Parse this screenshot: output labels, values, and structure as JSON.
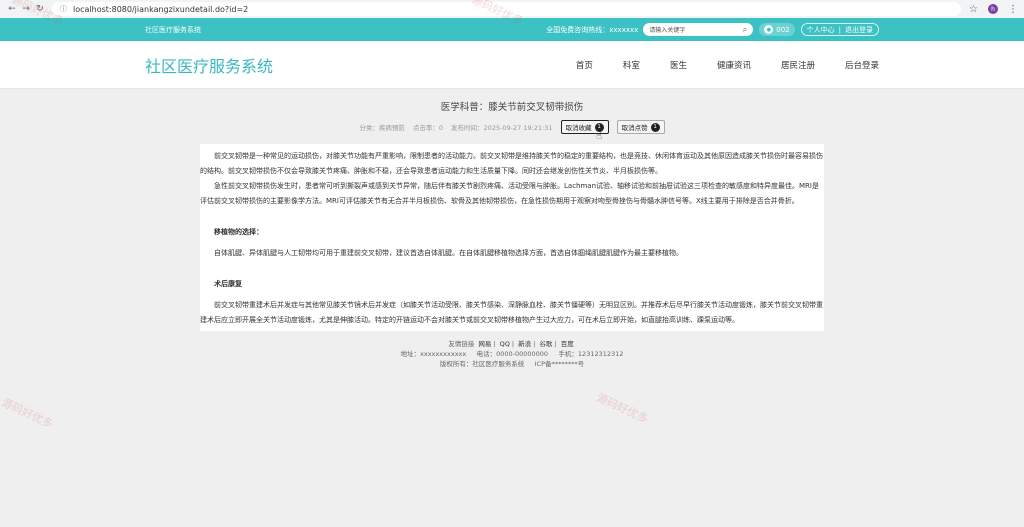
{
  "browser": {
    "url": "localhost:8080/jiankangzixundetail.do?id=2",
    "profile_initial": "h"
  },
  "topbar": {
    "site_name": "社区医疗服务系统",
    "hotline_label": "全国免费咨询热线：",
    "hotline_number": "xxxxxxx",
    "search_placeholder": "请输入关键字",
    "user": "002",
    "user_center": "个人中心",
    "logout": "退出登录"
  },
  "header": {
    "brand": "社区医疗服务系统",
    "nav": [
      "首页",
      "科室",
      "医生",
      "健康资讯",
      "居民注册",
      "后台登录"
    ]
  },
  "article": {
    "title": "医学科普：膝关节前交叉韧带损伤",
    "category_label": "分类：",
    "category": "疾病预防",
    "clicks_label": "点击率：",
    "clicks": "0",
    "publish_label": "发布时间：",
    "publish_time": "2025-09-27 19:21:31",
    "btn_unfavorite": "取消收藏",
    "fav_count": "1",
    "btn_unlike": "取消点赞",
    "like_count": "1",
    "p1": "前交叉韧带是一种常见的运动损伤，对膝关节功能有严重影响，限制患者的活动能力。前交叉韧带是维持膝关节的稳定的重要结构，也是竞技、休闲体育运动及其他原因造成膝关节损伤时最容易损伤的结构。前交叉韧带损伤不仅会导致膝关节疼痛、肿胀和不稳，还会导致患者运动能力和生活质量下降。同时还会继发创伤性关节炎、半月板损伤等。",
    "p2": "急性前交叉韧带损伤发生时，患者常可听到撕裂声或感到关节异常，随后伴有膝关节剧烈疼痛、活动受限与肿胀。Lachman试验、轴移试验和前抽屉试验这三项检查的敏感度和特异度最佳。MRI是评估前交叉韧带损伤的主要影像学方法。MRI可评估膝关节有无合并半月板损伤、软骨及其他韧带损伤，在急性损伤期用于观察对吻型骨挫伤与骨髓水肿信号等。X线主要用于排除是否合并骨折。",
    "h1": "移植物的选择：",
    "p3": "自体肌腱、异体肌腱与人工韧带均可用于重建前交叉韧带，建议首选自体肌腱。在自体肌腱移植物选择方面，首选自体腘绳肌腱肌腱作为最主要移植物。",
    "h2": "术后康复",
    "p4": "前交叉韧带重建术后并发症与其他常见膝关节镜术后并发症（如膝关节活动受限、膝关节感染、深静脉血栓、膝关节僵硬等）无明显区别。并推荐术后尽早行膝关节活动度锻炼，膝关节前交叉韧带重建术后应立即开展全关节活动度锻炼，尤其是伸膝活动。特定的开链运动不会对膝关节或前交叉韧带移植物产生过大应力，可在术后立即开始，如直腿抬高训练、踝泵运动等。"
  },
  "footer": {
    "friend_links_label": "友情链接",
    "links": [
      "网易",
      "QQ",
      "新浪",
      "谷歌",
      "百度"
    ],
    "address_label": "地址：",
    "address": "xxxxxxxxxxxx",
    "phone_label": "电话：",
    "phone": "0000-00000000",
    "mobile_label": "手机：",
    "mobile": "12312312312",
    "copyright": "版权所有：社区医疗服务系统",
    "icp": "ICP备********号"
  },
  "watermark": "源码好优多"
}
